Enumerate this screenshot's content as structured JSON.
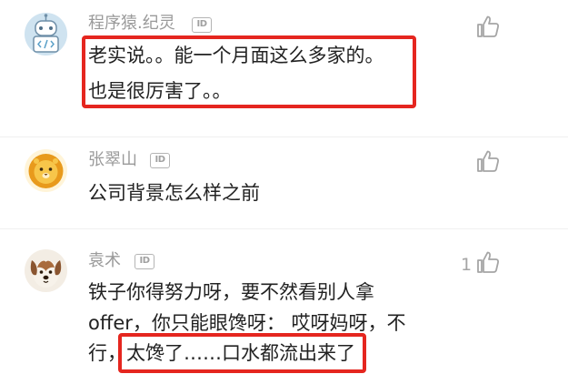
{
  "comments": [
    {
      "username": "程序猿.纪灵",
      "id_badge": "ID",
      "avatar": "robot-avatar-icon",
      "like_icon": "thumbs-up-icon",
      "like_count": "",
      "lines": [
        "老实说。。能一个月面这么多家的。",
        "也是很厉害了。。"
      ]
    },
    {
      "username": "张翠山",
      "id_badge": "ID",
      "avatar": "lion-avatar-icon",
      "like_icon": "thumbs-up-icon",
      "like_count": "",
      "lines": [
        "公司背景怎么样之前"
      ]
    },
    {
      "username": "袁术",
      "id_badge": "ID",
      "avatar": "dog-avatar-icon",
      "like_icon": "thumbs-up-icon",
      "like_count": "1",
      "lines": [
        "铁子你得努力呀，要不然看别人拿",
        "offer，你只能眼馋呀：  哎呀妈呀，不",
        "行，太馋了……口水都流出来了"
      ]
    }
  ],
  "colors": {
    "highlight": "#e5261f",
    "username": "#9a9a9a",
    "text": "#222222",
    "icon": "#a5a5a5"
  }
}
